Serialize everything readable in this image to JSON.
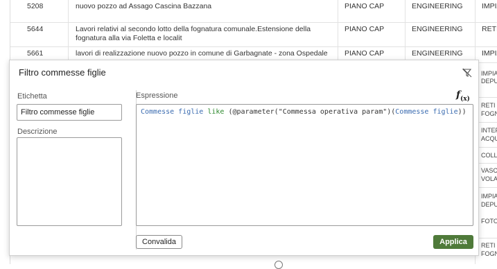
{
  "table": {
    "rows": [
      {
        "id": "5208",
        "desc": "nuovo pozzo ad Assago Cascina Bazzana",
        "client": "PIANO CAP",
        "division": "ENGINEERING",
        "type": "IMPIA ACQU"
      },
      {
        "id": "5644",
        "desc": "Lavori relativi al secondo lotto della fognatura comunale.Estensione della fognatura alla via Foletta e localit",
        "client": "PIANO CAP",
        "division": "ENGINEERING",
        "type": "RETI FOGN"
      },
      {
        "id": "5661",
        "desc": "lavori di realizzazione nuovo pozzo in comune di Garbagnate - zona Ospedale",
        "client": "PIANO CAP",
        "division": "ENGINEERING",
        "type": "IMPIA ACQU"
      }
    ],
    "right_column": [
      "IMPIA",
      "DEPU",
      "RETI",
      "FOGN",
      "INTEF",
      "ACQU",
      "COLL",
      "VASC",
      "VOLA",
      "IMPIA",
      "DEPU",
      "FOTO",
      "RETI",
      "FOGN"
    ]
  },
  "dialog": {
    "title": "Filtro commesse figlie",
    "label_label": "Etichetta",
    "label_value": "Filtro commesse figlie",
    "description_label": "Descrizione",
    "description_value": "",
    "expression_label": "Espressione",
    "expression": {
      "field1": "Commesse figlie",
      "operator": "like",
      "mid": " (@parameter(\"Commessa operativa param\")(",
      "field2": "Commesse figlie",
      "end": "))"
    },
    "validate_label": "Convalida",
    "apply_label": "Applica"
  },
  "icons": {
    "filter_clear": "filter-clear-icon",
    "function": "fx-icon"
  },
  "colors": {
    "apply_button": "#4f7a3a",
    "field_token": "#3a6bb0",
    "operator_token": "#2f8a2f"
  }
}
